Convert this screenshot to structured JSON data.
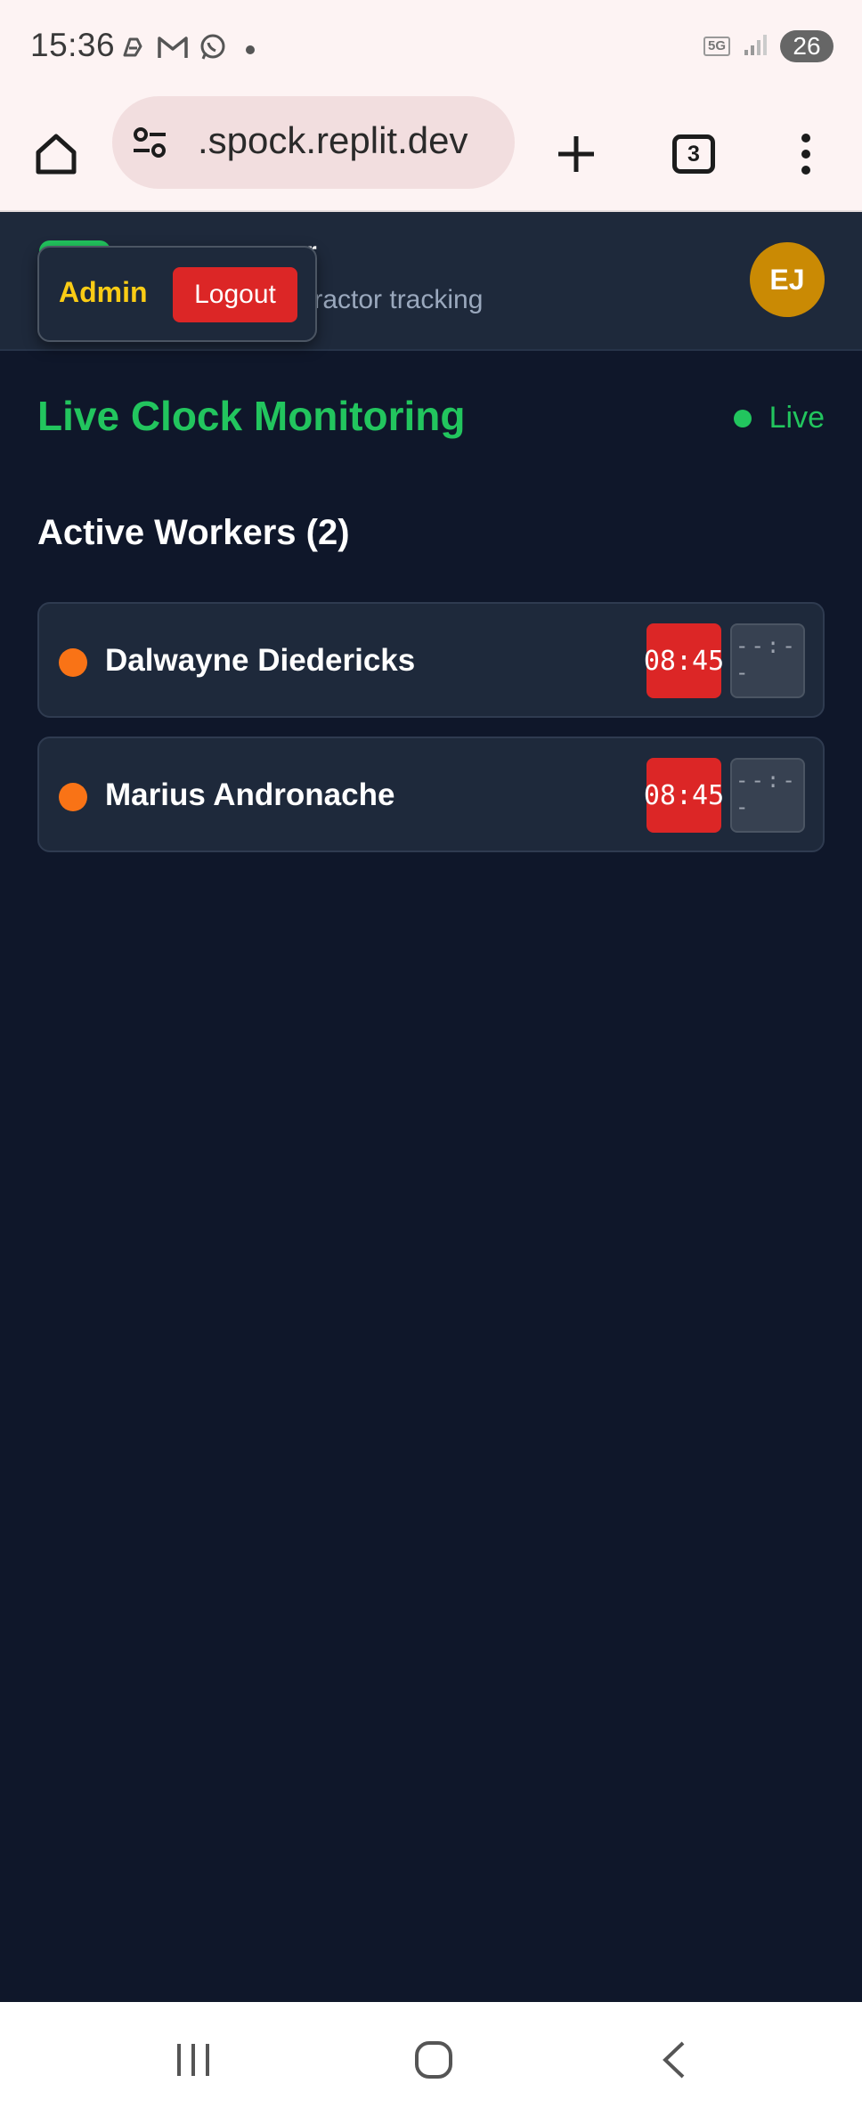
{
  "status_bar": {
    "time": "15:36",
    "notification_icons": [
      "copilot-icon",
      "gmail-icon",
      "whatsapp-icon"
    ],
    "network": "5G",
    "battery": "26"
  },
  "browser": {
    "url": ".spock.replit.dev",
    "tab_count": "3"
  },
  "header": {
    "title_fragment": "r",
    "subtitle_fragment": "tractor tracking",
    "avatar_initials": "EJ"
  },
  "user_menu": {
    "role": "Admin",
    "logout_label": "Logout"
  },
  "main": {
    "title": "Live Clock Monitoring",
    "live_label": "Live",
    "section_title": "Active Workers (2)",
    "workers": [
      {
        "name": "Dalwayne Diedericks",
        "clock_in": "08:45",
        "clock_out": "--:--"
      },
      {
        "name": "Marius Andronache",
        "clock_in": "08:45",
        "clock_out": "--:--"
      }
    ]
  },
  "colors": {
    "accent_green": "#22c55e",
    "background": "#0f172a",
    "card": "#1e293b",
    "danger_red": "#dc2626",
    "status_orange": "#f97316",
    "admin_yellow": "#facc15",
    "avatar_gold": "#ca8a04"
  }
}
